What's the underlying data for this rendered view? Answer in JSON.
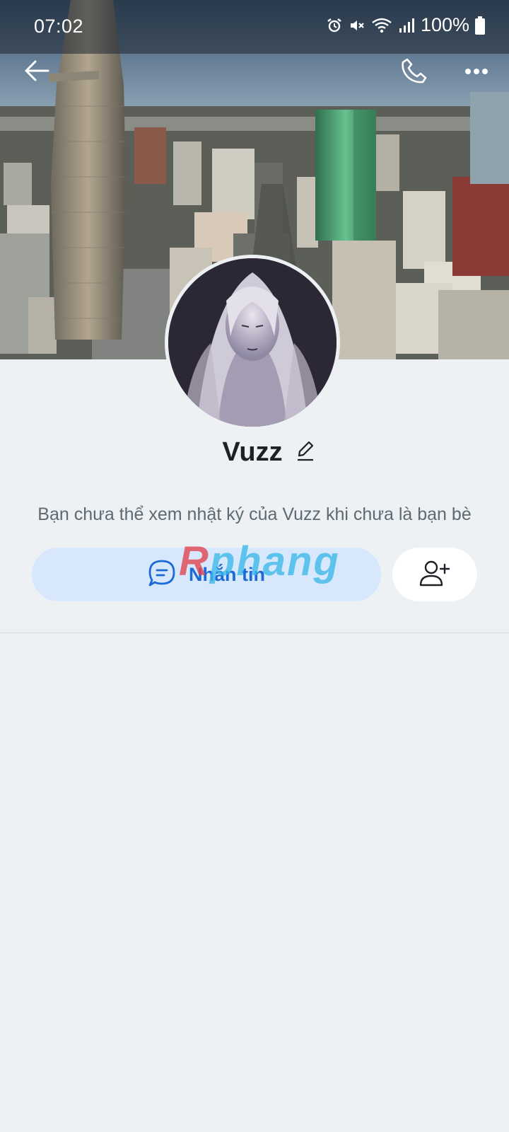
{
  "status_bar": {
    "time": "07:02",
    "battery_percent": "100%",
    "icons": [
      "alarm-icon",
      "mute-icon",
      "wifi-icon",
      "signal-icon",
      "battery-icon"
    ]
  },
  "top_nav": {
    "back_icon": "arrow-left-icon",
    "call_icon": "phone-icon",
    "more_icon": "more-horizontal-icon"
  },
  "profile": {
    "name": "Vuzz",
    "info_message": "Bạn chưa thể xem nhật ký của Vuzz khi chưa là bạn bè"
  },
  "actions": {
    "message_label": "Nhắn tin",
    "message_icon": "chat-bubble-icon",
    "add_friend_icon": "user-plus-icon"
  },
  "watermark": {
    "first_letter": "R",
    "rest": "phang"
  },
  "colors": {
    "background": "#eef1f3",
    "accent": "#1b6ad6",
    "message_button_bg": "#d7e8fc",
    "watermark_red": "#e3414d",
    "watermark_blue": "#3bb8e8"
  }
}
